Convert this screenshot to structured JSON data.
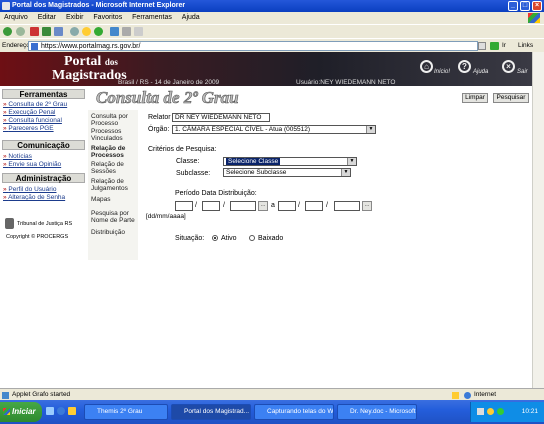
{
  "window": {
    "title": "Portal dos Magistrados - Microsoft Internet Explorer",
    "controls": [
      "_",
      "□",
      "×"
    ]
  },
  "menu": [
    "Arquivo",
    "Editar",
    "Exibir",
    "Favoritos",
    "Ferramentas",
    "Ajuda"
  ],
  "address": {
    "label": "Endereço",
    "url": "https://www.portalmag.rs.gov.br/",
    "go": "Ir",
    "links": "Links"
  },
  "header": {
    "logo_line1": "Portal",
    "logo_dos": "dos",
    "logo_line2": "Magistrados",
    "date": "Brasil / RS - 14 de Janeiro de 2009",
    "user": "Usuário:NEY WIEDEMANN NETO",
    "inicio": "Início!",
    "ajuda": "Ajuda",
    "sair": "Sair"
  },
  "nav": {
    "ferramentas": "Ferramentas",
    "ferramentas_links": [
      "Consulta de 2º Grau",
      "Execução Penal",
      "Consulta funcional",
      "Pareceres PGE"
    ],
    "comunicacao": "Comunicação",
    "comunicacao_links": [
      "Notícias",
      "Envie sua Opinião"
    ],
    "administracao": "Administração",
    "administracao_links": [
      "Perfil do Usuário",
      "Alteração de Senha"
    ],
    "tribunal": "Tribunal de Justiça RS",
    "copyright": "Copyright © PROCERGS"
  },
  "submenu": [
    "Consulta por Processo",
    "Processos Vinculados",
    "Relação de Processos",
    "Relação de Sessões",
    "Relação de Julgamentos",
    "Mapas",
    "Pesquisa por Nome de Parte",
    "Distribuição"
  ],
  "main": {
    "title": "Consulta de 2º Grau",
    "limpar": "Limpar",
    "pesquisar": "Pesquisar",
    "relator_label": "Relator",
    "relator_value": "DR NEY WIEDEMANN NETO",
    "orgao_label": "Órgão:",
    "orgao_value": "1. CÂMARA ESPECIAL CÍVEL - Atua (005512)",
    "criterios": "Critérios de Pesquisa:",
    "classe_label": "Classe:",
    "classe_value": "Selecione Classe",
    "subclasse_label": "Subclasse:",
    "subclasse_value": "Selecione Subclasse",
    "periodo_label": "Período Data Distribuição:",
    "date_format": "[dd/mm/aaaa]",
    "sep": "/",
    "a": "a",
    "situacao_label": "Situação:",
    "ativo": "Ativo",
    "baixado": "Baixado"
  },
  "status": {
    "text": "Applet Grafo started",
    "zone": "Internet"
  },
  "taskbar": {
    "start": "Iniciar",
    "tasks": [
      "Themis 2º Grau",
      "Portal dos Magistrad...",
      "Capturando telas do Win...",
      "Dr. Ney.doc - Microsoft ..."
    ],
    "clock": "10:21"
  }
}
